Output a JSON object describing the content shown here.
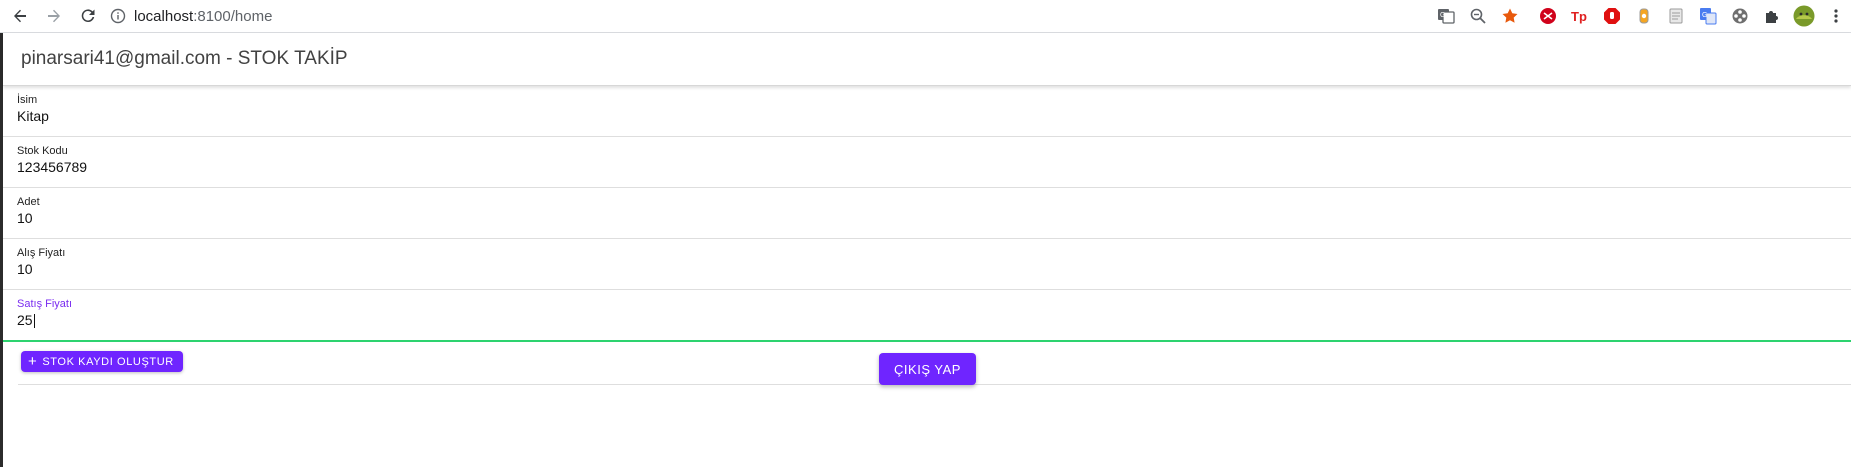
{
  "browser": {
    "url_host": "localhost",
    "url_rest": ":8100/home",
    "icons": [
      "back-arrow-icon",
      "forward-arrow-icon",
      "reload-icon",
      "info-icon",
      "translate-icon",
      "zoom-icon",
      "bookmark-star-icon",
      "extension-icons",
      "menu-kebab-icon"
    ]
  },
  "header": {
    "title": "pinarsari41@gmail.com - STOK TAKİP"
  },
  "form": {
    "fields": [
      {
        "label": "İsim",
        "value": "Kitap"
      },
      {
        "label": "Stok Kodu",
        "value": "123456789"
      },
      {
        "label": "Adet",
        "value": "10"
      },
      {
        "label": "Alış Fiyatı",
        "value": "10"
      },
      {
        "label": "Satış Fiyatı",
        "value": "25"
      }
    ],
    "create_button": "STOK KAYDI OLUŞTUR"
  },
  "logout_button": "ÇIKIŞ YAP",
  "colors": {
    "primary": "#6f25ff",
    "focus_underline": "#2dd36f",
    "focus_label": "#7a2cf0"
  }
}
